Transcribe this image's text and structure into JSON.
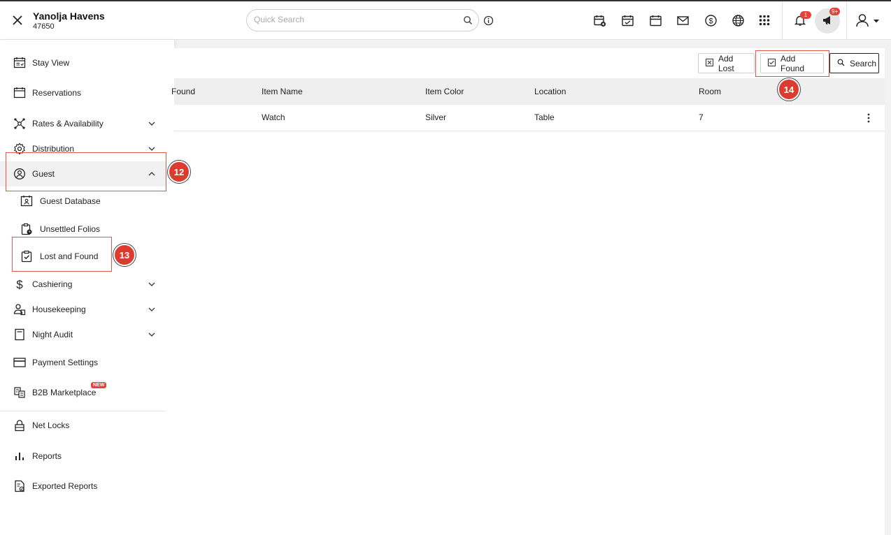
{
  "header": {
    "hotel_name": "Yanolja Havens",
    "hotel_id": "47650",
    "search_placeholder": "Quick Search",
    "notification_count": "1",
    "announcement_count": "9+",
    "icons": [
      "calendar-add-icon",
      "calendar-check-icon",
      "calendar-icon",
      "mail-icon",
      "dollar-icon",
      "globe-icon",
      "apps-grid-icon",
      "bell-icon",
      "megaphone-icon",
      "user-icon"
    ]
  },
  "sidebar": {
    "items": [
      {
        "label": "Stay View",
        "icon": "stay-view-icon"
      },
      {
        "label": "Reservations",
        "icon": "calendar-icon"
      },
      {
        "label": "Rates & Availability",
        "icon": "network-icon"
      },
      {
        "label": "Distribution",
        "icon": "gear-icon"
      },
      {
        "label": "Guest",
        "icon": "guest-icon"
      },
      {
        "label": "Guest Database",
        "icon": "guest-database-icon"
      },
      {
        "label": "Unsettled Folios",
        "icon": "clipboard-clock-icon"
      },
      {
        "label": "Lost and Found",
        "icon": "clipboard-check-icon"
      },
      {
        "label": "Cashiering",
        "icon": "dollar-icon"
      },
      {
        "label": "Housekeeping",
        "icon": "housekeeping-icon"
      },
      {
        "label": "Night Audit",
        "icon": "document-icon"
      },
      {
        "label": "Payment Settings",
        "icon": "card-icon"
      },
      {
        "label": "B2B Marketplace",
        "icon": "marketplace-icon"
      },
      {
        "label": "Net Locks",
        "icon": "lock-icon"
      },
      {
        "label": "Reports",
        "icon": "bar-chart-icon"
      },
      {
        "label": "Exported Reports",
        "icon": "export-report-icon"
      }
    ],
    "new_badge": "NEW"
  },
  "toolbar": {
    "add_lost": "Add Lost",
    "add_found": "Add Found",
    "search": "Search"
  },
  "table": {
    "columns": [
      "Found",
      "Item Name",
      "Item Color",
      "Location",
      "Room"
    ],
    "rows": [
      {
        "item_name": "Watch",
        "item_color": "Silver",
        "location": "Table",
        "room": "7"
      }
    ]
  },
  "annotations": [
    "12",
    "13",
    "14"
  ],
  "colors": {
    "accent": "#dd3b2f",
    "badge": "#e8403a",
    "header_bg": "#ffffff",
    "table_header_bg": "#efefef"
  }
}
